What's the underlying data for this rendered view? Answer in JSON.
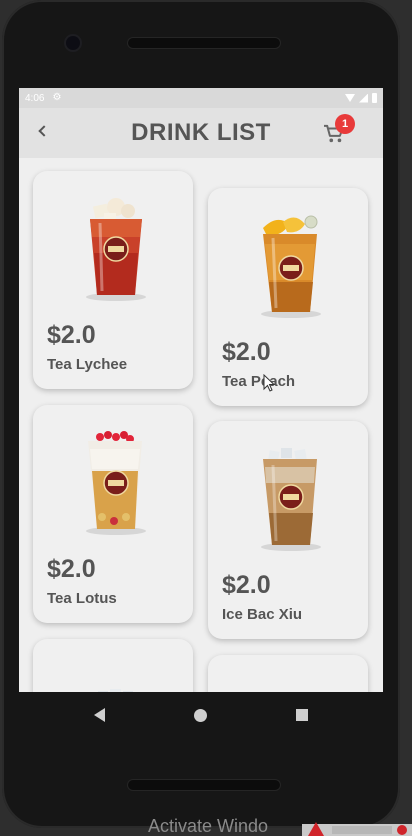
{
  "status_bar": {
    "time": "4:06"
  },
  "app_bar": {
    "title": "DRINK LIST",
    "cart_count": "1"
  },
  "drinks": [
    {
      "price": "$2.0",
      "name": "Tea Lychee"
    },
    {
      "price": "$2.0",
      "name": "Tea Peach"
    },
    {
      "price": "$2.0",
      "name": "Tea Lotus"
    },
    {
      "price": "$2.0",
      "name": "Ice Bac Xiu"
    }
  ],
  "watermark": {
    "text": "Activate Windo"
  },
  "colors": {
    "badge": "#e83a3a",
    "text": "#555555",
    "appbar": "#e2e2e2",
    "screen_bg": "#efefef"
  },
  "icons": [
    "back-arrow-icon",
    "cart-icon",
    "settings-icon",
    "wifi-icon",
    "signal-icon",
    "battery-icon"
  ]
}
